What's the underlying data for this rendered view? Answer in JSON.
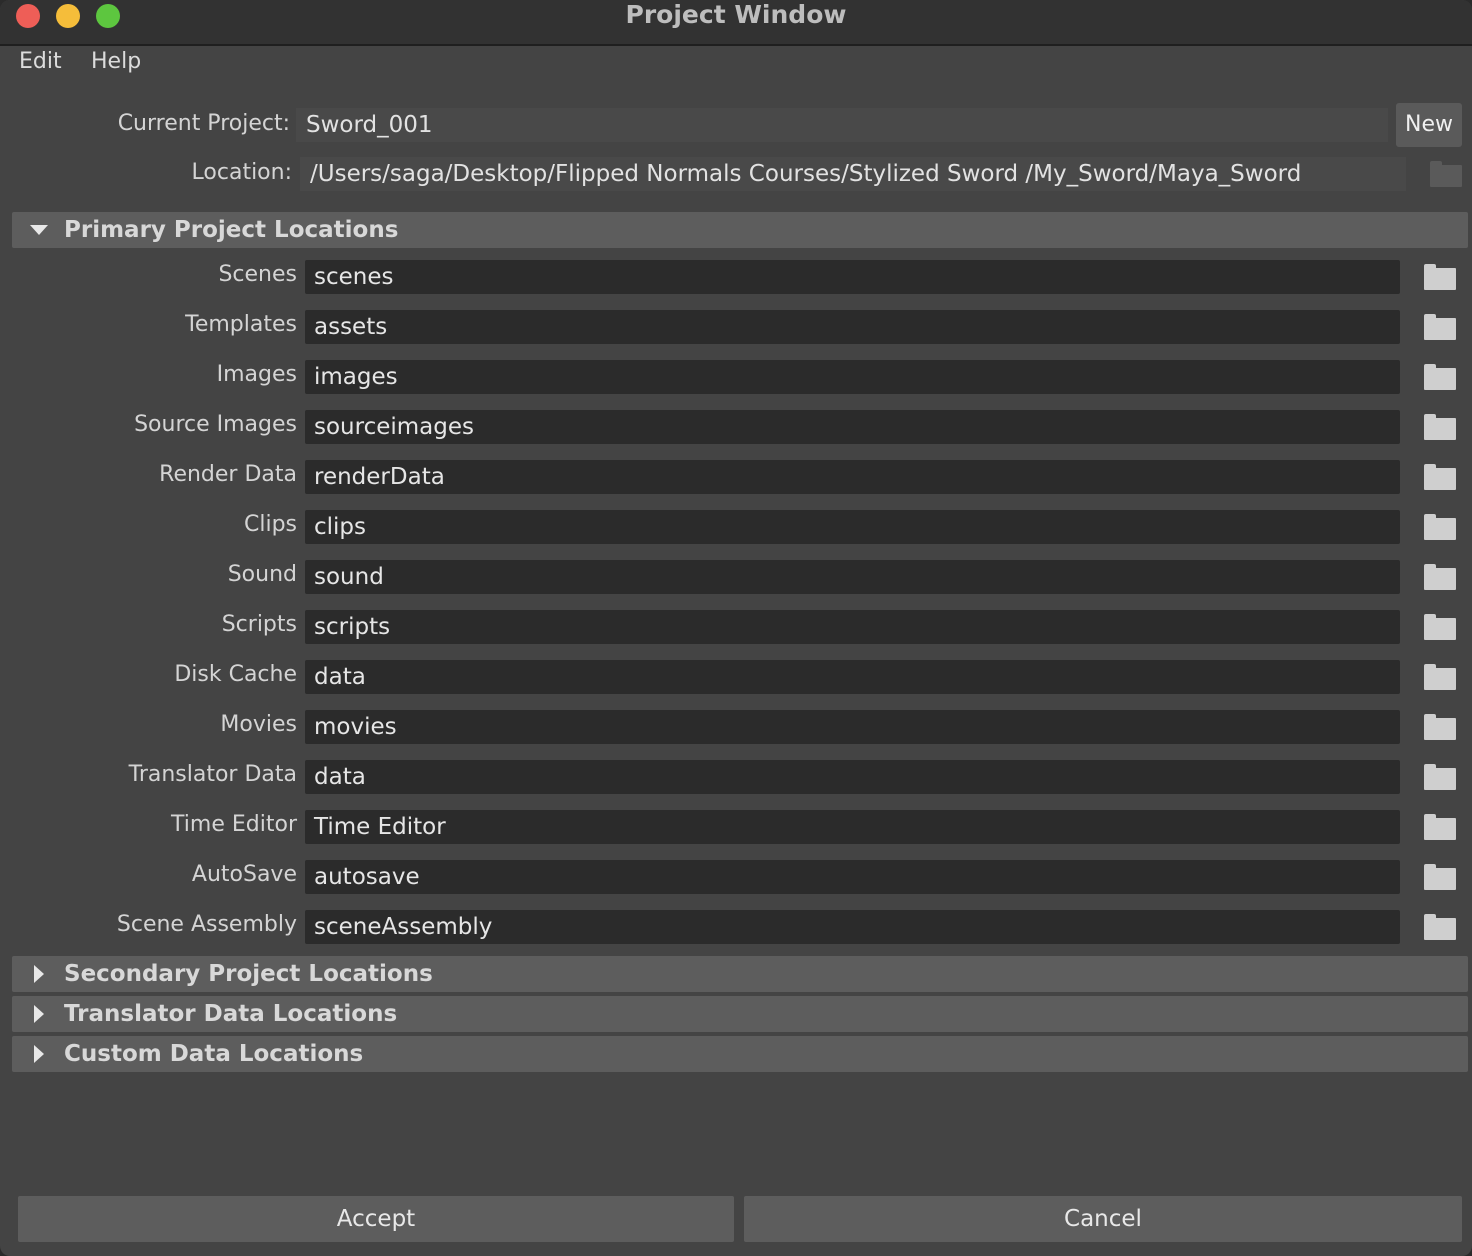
{
  "window": {
    "title": "Project Window"
  },
  "menu": {
    "items": [
      "Edit",
      "Help"
    ]
  },
  "project": {
    "current_label": "Current Project:",
    "current_value": "Sword_001",
    "new_label": "New",
    "location_label": "Location:",
    "location_value": "/Users/saga/Desktop/Flipped Normals Courses/Stylized Sword /My_Sword/Maya_Sword"
  },
  "sections": {
    "primary": "Primary Project Locations",
    "secondary": "Secondary Project Locations",
    "translator": "Translator Data Locations",
    "custom": "Custom Data Locations"
  },
  "primary_rows": [
    {
      "label": "Scenes",
      "value": "scenes"
    },
    {
      "label": "Templates",
      "value": "assets"
    },
    {
      "label": "Images",
      "value": "images"
    },
    {
      "label": "Source Images",
      "value": "sourceimages"
    },
    {
      "label": "Render Data",
      "value": "renderData"
    },
    {
      "label": "Clips",
      "value": "clips"
    },
    {
      "label": "Sound",
      "value": "sound"
    },
    {
      "label": "Scripts",
      "value": "scripts"
    },
    {
      "label": "Disk Cache",
      "value": "data"
    },
    {
      "label": "Movies",
      "value": "movies"
    },
    {
      "label": "Translator Data",
      "value": "data"
    },
    {
      "label": "Time Editor",
      "value": "Time Editor"
    },
    {
      "label": "AutoSave",
      "value": "autosave"
    },
    {
      "label": "Scene Assembly",
      "value": "sceneAssembly"
    }
  ],
  "buttons": {
    "accept": "Accept",
    "cancel": "Cancel"
  }
}
